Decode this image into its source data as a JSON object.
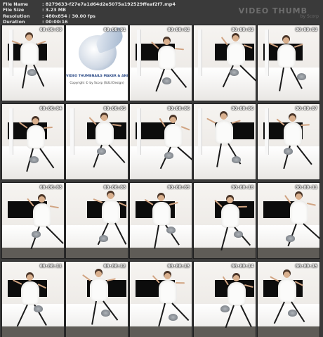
{
  "file_info": {
    "file_name_label": "File Name",
    "file_name_value": ": 8279633-f27e7a1d64d2e5075a192529ffeaf2f7.mp4",
    "file_size_label": "File Size",
    "file_size_value": ": 3.23 MB",
    "resolution_label": "Resolution",
    "resolution_value": ": 480x854 / 30.00 fps",
    "duration_label": "Duration",
    "duration_value": ": 00:00:16"
  },
  "brand": {
    "title": "VIDEO THUMB",
    "subtitle": "by Scorp"
  },
  "logo": {
    "title": "VIDEO THUMBNAILS MAKER & ANIMAT",
    "copyright": "Copyright © by Scorp (SULI Design)"
  },
  "thumbnails": [
    {
      "timestamp": "00:00:00"
    },
    {
      "timestamp": "00:00:01"
    },
    {
      "timestamp": "00:00:02"
    },
    {
      "timestamp": "00:00:03"
    },
    {
      "timestamp": "00:00:03"
    },
    {
      "timestamp": "00:00:04"
    },
    {
      "timestamp": "00:00:05"
    },
    {
      "timestamp": "00:00:06"
    },
    {
      "timestamp": "00:00:06"
    },
    {
      "timestamp": "00:00:07"
    },
    {
      "timestamp": "00:00:08"
    },
    {
      "timestamp": "00:00:08"
    },
    {
      "timestamp": "00:00:09"
    },
    {
      "timestamp": "00:00:10"
    },
    {
      "timestamp": "00:00:11"
    },
    {
      "timestamp": "00:00:11"
    },
    {
      "timestamp": "00:00:12"
    },
    {
      "timestamp": "00:00:13"
    },
    {
      "timestamp": "00:00:14"
    },
    {
      "timestamp": "00:00:15"
    }
  ]
}
